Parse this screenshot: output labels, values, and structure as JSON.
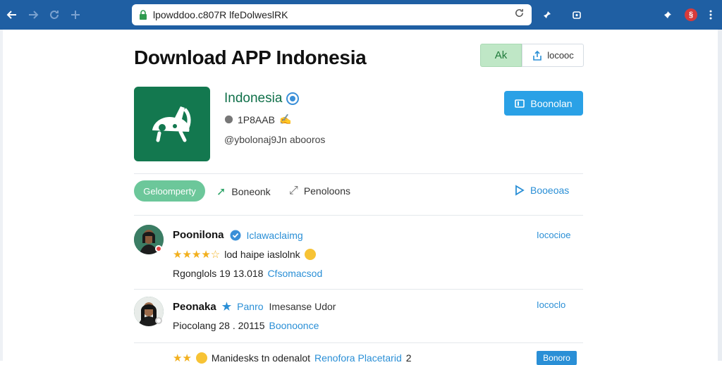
{
  "browser": {
    "url": "lpowddoo.c807R lfeDolweslRK",
    "icons": [
      "back-arrow-icon",
      "forward-arrow-icon",
      "reload-icon",
      "extension-icon",
      "lock-icon",
      "bookmark-icon",
      "profile-icon"
    ]
  },
  "header": {
    "title": "Download APP Indonesia",
    "lang_label": "Ak",
    "share_label": "locooc"
  },
  "app": {
    "name": "Indonesia",
    "meta": "1P8AAB",
    "developer": "@ybolonaj9Jn abooros",
    "download_label": "Boonolan"
  },
  "tabs": {
    "active": "Geloomperty",
    "tab2": "Boneonk",
    "tab3": "Penoloons",
    "reviews": "Booeoas"
  },
  "reviews": [
    {
      "name": "Poonilona",
      "tag": "Iclawaclaimg",
      "text": "lod haipe iaslolnk",
      "date": "Rgonglols 19 13.018",
      "link": "Cfsomacsod",
      "action": "Iococioe",
      "rating": 3.5
    },
    {
      "name": "Peonaka",
      "tag": "Panro",
      "tag_extra": "Imesanse Udor",
      "date": "Piocolang 28 . 20115",
      "link": "Boonoonce",
      "action": "Iococlo"
    },
    {
      "text": "Manidesks tn odenalot",
      "link": "Renofora Placetarid",
      "extra": "2",
      "action": "Bonoro",
      "rating": 2
    }
  ],
  "colors": {
    "browser_bar": "#1f5fa3",
    "brand_green": "#13784f",
    "accent_blue": "#2aa1e6",
    "tab_green": "#6cc79a",
    "star": "#f2b01e"
  }
}
